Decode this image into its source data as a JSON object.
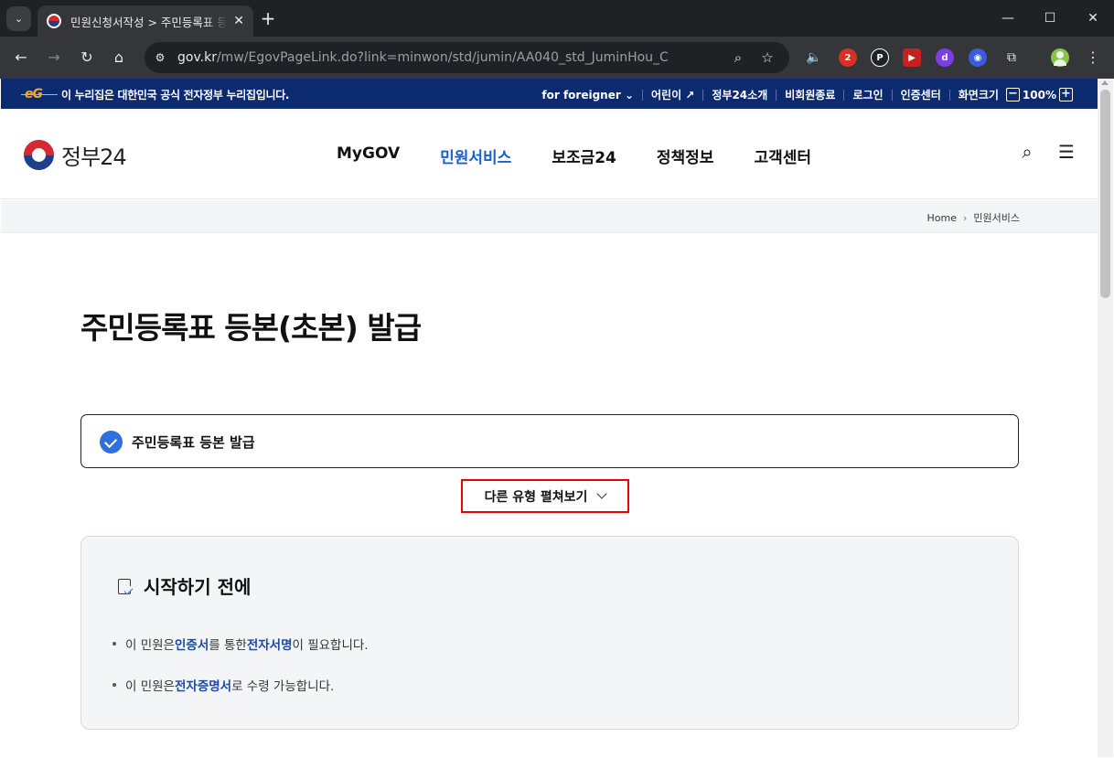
{
  "browser": {
    "tab_title": "민원신청서작성 > 주민등록표 등본",
    "url_host": "gov.kr",
    "url_path": "/mw/EgovPageLink.do?link=minwon/std/jumin/AA040_std_JuminHou_C",
    "extensions": [
      {
        "name": "ext-red-badge",
        "badge": "2",
        "color": "#d93025"
      },
      {
        "name": "ext-dark-p",
        "badge": "P",
        "color": "#202124"
      },
      {
        "name": "ext-red-square",
        "badge": "▶",
        "color": "#c5221f"
      },
      {
        "name": "ext-purple",
        "badge": "d",
        "color": "#7b3fe4"
      },
      {
        "name": "ext-colorful",
        "badge": "◉",
        "color": "#3b5bdb"
      }
    ]
  },
  "govbar": {
    "logo": "eG",
    "notice": "이 누리집은 대한민국 공식 전자정부 누리집입니다.",
    "foreigner": "for foreigner",
    "kids": "어린이",
    "about": "정부24소개",
    "guest_logout": "비회원종료",
    "login": "로그인",
    "cert_center": "인증센터",
    "screen_size_label": "화면크기",
    "zoom": "100%",
    "zoom_minus": "−",
    "zoom_plus": "+"
  },
  "header": {
    "logo_text": "정부24",
    "nav": [
      "MyGOV",
      "민원서비스",
      "보조금24",
      "정책정보",
      "고객센터"
    ],
    "active_nav": "민원서비스"
  },
  "breadcrumb": {
    "home": "Home",
    "current": "민원서비스"
  },
  "page": {
    "title": "주민등록표 등본(초본) 발급",
    "selected_type": "주민등록표 등본 발급",
    "expand_label": "다른 유형 펼쳐보기",
    "info_heading": "시작하기 전에",
    "info_items": [
      {
        "pre": "이 민원은 ",
        "b1": "인증서",
        "mid": "를 통한 ",
        "b2": "전자서명",
        "post": "이 필요합니다."
      },
      {
        "pre": "이 민원은 ",
        "b1": "전자증명서",
        "mid": "로 수령 가능합니다.",
        "b2": "",
        "post": ""
      }
    ]
  }
}
